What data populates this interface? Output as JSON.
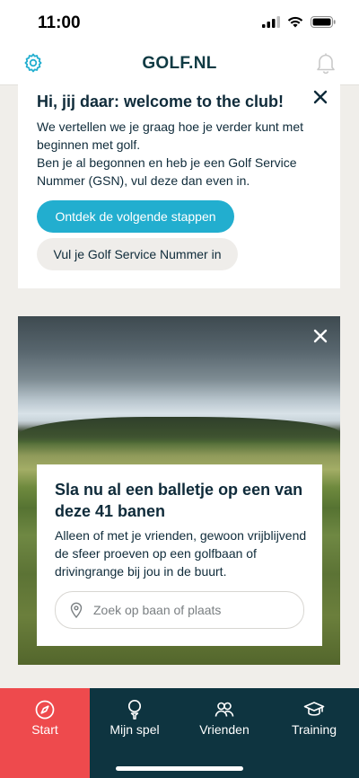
{
  "status_bar": {
    "time": "11:00"
  },
  "header": {
    "logo": "GOLF.NL",
    "settings_icon": "gear-icon",
    "notifications_icon": "bell-icon"
  },
  "welcome_card": {
    "title": "Hi, jij daar: welcome to the club!",
    "body_line1": "We vertellen we je graag hoe je verder kunt met beginnen met golf.",
    "body_line2": "Ben je al begonnen en heb je een Golf Service Nummer (GSN), vul deze dan even in.",
    "primary_button": "Ontdek de volgende stappen",
    "secondary_button": "Vul je Golf Service Nummer in",
    "close_icon": "close-icon"
  },
  "course_card": {
    "title": "Sla nu al een balletje op een van deze 41 banen",
    "body": "Alleen of met je vrienden, gewoon vrijblijvend de sfeer proeven op een golfbaan of drivingrange bij jou in de buurt.",
    "search_placeholder": "Zoek op baan of plaats",
    "search_icon": "location-pin-icon",
    "close_icon": "close-icon"
  },
  "bottom_nav": {
    "items": [
      {
        "label": "Start",
        "icon": "compass-icon",
        "active": true
      },
      {
        "label": "Mijn spel",
        "icon": "golf-ball-tee-icon",
        "active": false
      },
      {
        "label": "Vrienden",
        "icon": "friends-icon",
        "active": false
      },
      {
        "label": "Training",
        "icon": "graduation-cap-icon",
        "active": false
      }
    ]
  },
  "colors": {
    "accent": "#22aecf",
    "nav_background": "#0e3440",
    "nav_active": "#ee4a4d"
  }
}
